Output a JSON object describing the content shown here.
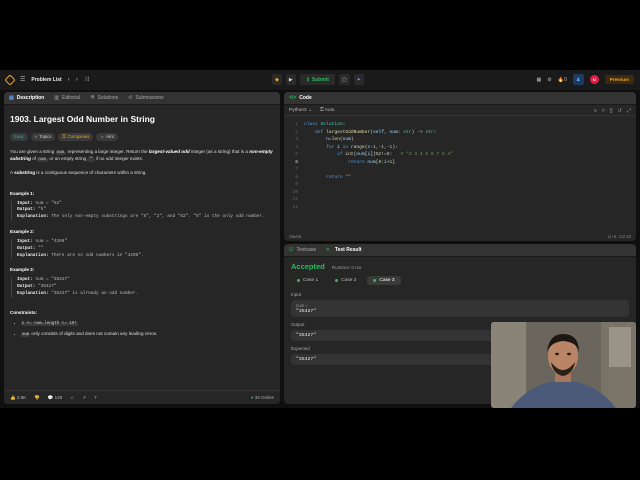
{
  "nav": {
    "problem_list": "Problem List",
    "submit": "Submit",
    "streak": "0",
    "avatar": "M",
    "premium": "Premium"
  },
  "left_tabs": [
    "Description",
    "Editorial",
    "Solutions",
    "Submissions"
  ],
  "problem": {
    "title": "1903. Largest Odd Number in String",
    "tags": {
      "difficulty": "Easy",
      "topics": "Topics",
      "companies": "Companies",
      "hint": "Hint"
    },
    "p1": {
      "a": "You are given a string ",
      "b": "num",
      "c": ", representing a large integer. Return the ",
      "d": "largest-valued odd",
      "e": " integer (as a string) that is a ",
      "f": "non-empty substring",
      "g": " of ",
      "h": "num",
      "i": ", or an empty string ",
      "j": "\"\"",
      "k": " if no odd integer exists."
    },
    "p2": {
      "a": "A ",
      "b": "substring",
      "c": " is a contiguous sequence of characters within a string."
    },
    "examples": [
      {
        "heading": "Example 1:",
        "input_label": "Input:",
        "input": "num = \"52\"",
        "output_label": "Output:",
        "output": "\"5\"",
        "expl_label": "Explanation:",
        "explanation": "The only non-empty substrings are \"5\", \"2\", and \"52\". \"5\" is the only odd number."
      },
      {
        "heading": "Example 2:",
        "input_label": "Input:",
        "input": "num = \"4206\"",
        "output_label": "Output:",
        "output": "\"\"",
        "expl_label": "Explanation:",
        "explanation": "There are no odd numbers in \"4206\"."
      },
      {
        "heading": "Example 3:",
        "input_label": "Input:",
        "input": "num = \"35427\"",
        "output_label": "Output:",
        "output": "\"35427\"",
        "expl_label": "Explanation:",
        "explanation": "\"35427\" is already an odd number."
      }
    ],
    "constraints_heading": "Constraints:",
    "constraints": [
      "1 <= num.length <= 10⁵",
      "only consists of digits and does not contain any leading zeros."
    ],
    "constraint_var": "num"
  },
  "footer": {
    "likes": "2.6K",
    "comments": "148",
    "online": "39 Online"
  },
  "code": {
    "tab": "Code",
    "language": "Python3",
    "auto": "Auto",
    "status_left": "Saved",
    "status_right": "Ln 6, Col 34"
  },
  "test": {
    "tab_testcase": "Testcase",
    "tab_result": "Test Result",
    "status": "Accepted",
    "runtime": "Runtime: 0 ms",
    "cases": [
      "Case 1",
      "Case 2",
      "Case 3"
    ],
    "input_label": "Input",
    "input_var": "num =",
    "input_value": "\"35427\"",
    "output_label": "Output",
    "output_value": "\"35427\"",
    "expected_label": "Expected",
    "expected_value": "\"35427\""
  },
  "colors": {
    "accepted": "#2cbb5d",
    "easy": "#2db5a3",
    "accent": "#f5a623"
  }
}
